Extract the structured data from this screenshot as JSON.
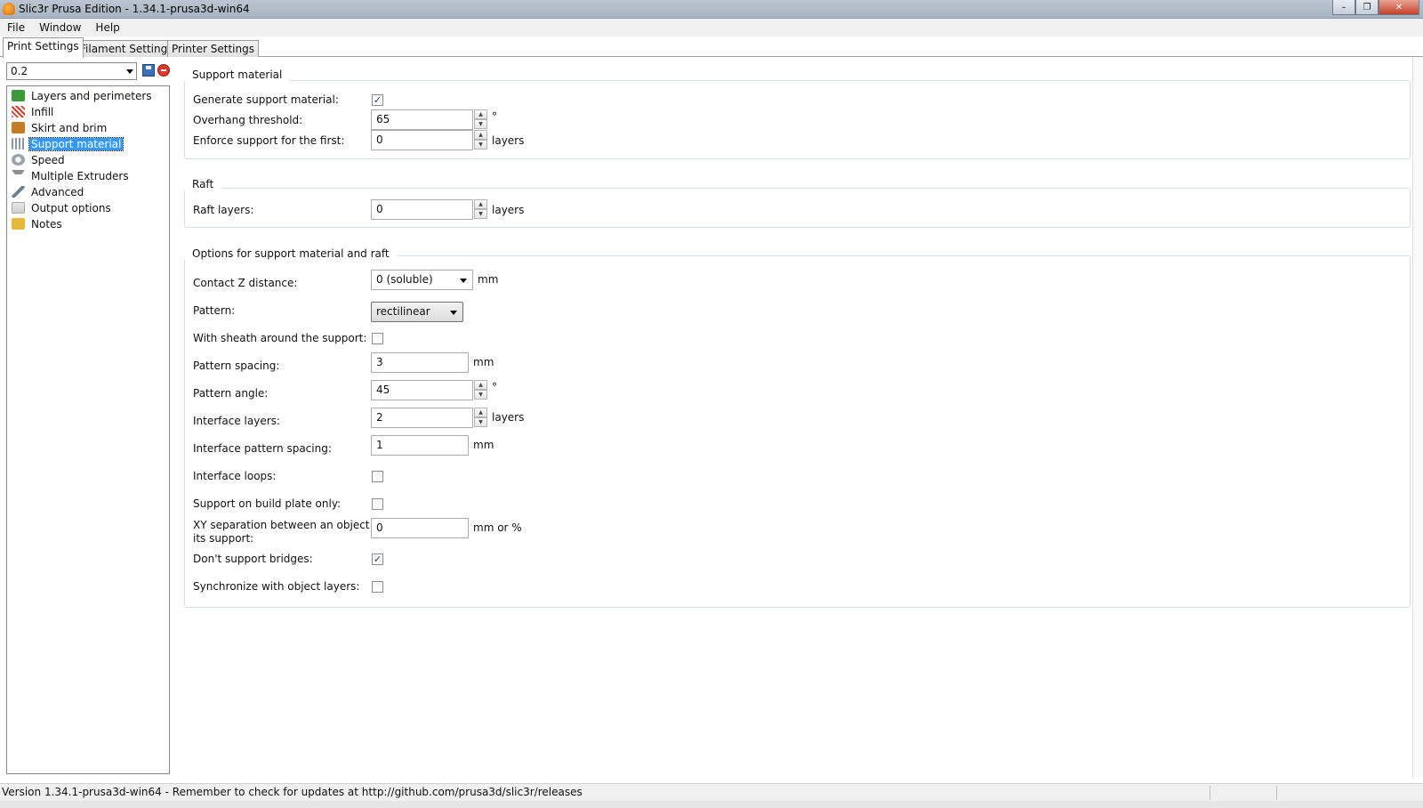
{
  "window": {
    "title": "Slic3r Prusa Edition - 1.34.1-prusa3d-win64",
    "minimize": "–",
    "maximize": "❐",
    "close": "✕"
  },
  "menu": [
    "File",
    "Window",
    "Help"
  ],
  "tabs": [
    "Print Settings",
    "Filament Settings",
    "Printer Settings"
  ],
  "preset": {
    "value": "0.2"
  },
  "sidebar": {
    "items": [
      {
        "label": "Layers and perimeters",
        "icon": "layers-icon",
        "color": "#3c9a3c"
      },
      {
        "label": "Infill",
        "icon": "infill-icon",
        "color": "#d23c2a"
      },
      {
        "label": "Skirt and brim",
        "icon": "skirt-brim-icon",
        "color": "#c97a26"
      },
      {
        "label": "Support material",
        "icon": "support-material-icon",
        "color": "#8a95a8"
      },
      {
        "label": "Speed",
        "icon": "speed-icon",
        "color": "#9aa3ad"
      },
      {
        "label": "Multiple Extruders",
        "icon": "funnel-icon",
        "color": "#8e8e8e"
      },
      {
        "label": "Advanced",
        "icon": "wrench-icon",
        "color": "#6f7f95"
      },
      {
        "label": "Output options",
        "icon": "output-icon",
        "color": "#4ea34e"
      },
      {
        "label": "Notes",
        "icon": "notes-icon",
        "color": "#e6b93b"
      }
    ],
    "selected_index": 3
  },
  "groups": {
    "support": {
      "title": "Support material",
      "generate_label": "Generate support material:",
      "generate_checked": true,
      "overhang_label": "Overhang threshold:",
      "overhang_value": "65",
      "overhang_unit": "°",
      "enforce_label": "Enforce support for the first:",
      "enforce_value": "0",
      "enforce_unit": "layers"
    },
    "raft": {
      "title": "Raft",
      "layers_label": "Raft layers:",
      "layers_value": "0",
      "layers_unit": "layers"
    },
    "options": {
      "title": "Options for support material and raft",
      "contact_z_label": "Contact Z distance:",
      "contact_z_value": "0 (soluble)",
      "contact_z_unit": "mm",
      "pattern_label": "Pattern:",
      "pattern_value": "rectilinear",
      "sheath_label": "With sheath around the support:",
      "sheath_checked": false,
      "spacing_label": "Pattern spacing:",
      "spacing_value": "3",
      "spacing_unit": "mm",
      "angle_label": "Pattern angle:",
      "angle_value": "45",
      "angle_unit": "°",
      "interface_layers_label": "Interface layers:",
      "interface_layers_value": "2",
      "interface_layers_unit": "layers",
      "interface_spacing_label": "Interface pattern spacing:",
      "interface_spacing_value": "1",
      "interface_spacing_unit": "mm",
      "interface_loops_label": "Interface loops:",
      "interface_loops_checked": false,
      "buildplate_label": "Support on build plate only:",
      "buildplate_checked": false,
      "xy_sep_label_1": "XY separation between an object and",
      "xy_sep_label_2": "its support:",
      "xy_sep_value": "0",
      "xy_sep_unit": "mm or %",
      "bridges_label": "Don't support bridges:",
      "bridges_checked": true,
      "sync_label": "Synchronize with object layers:",
      "sync_checked": false
    }
  },
  "statusbar": {
    "text": "Version 1.34.1-prusa3d-win64 - Remember to check for updates at http://github.com/prusa3d/slic3r/releases"
  }
}
